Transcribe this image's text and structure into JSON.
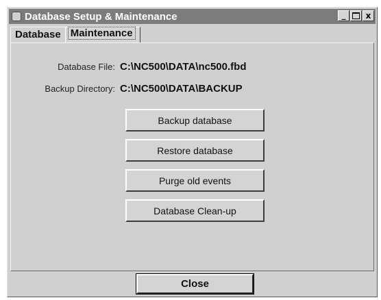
{
  "window": {
    "title": "Database Setup & Maintenance",
    "title_buttons": {
      "minimize_glyph": "_",
      "close_glyph": "x"
    }
  },
  "tabs": [
    {
      "label": "Database",
      "active": false
    },
    {
      "label": "Maintenance",
      "active": true
    }
  ],
  "maintenance": {
    "database_file_label": "Database File:",
    "database_file_value": "C:\\NC500\\DATA\\nc500.fbd",
    "backup_dir_label": "Backup Directory:",
    "backup_dir_value": "C:\\NC500\\DATA\\BACKUP",
    "buttons": [
      "Backup database",
      "Restore database",
      "Purge old events",
      "Database Clean-up"
    ]
  },
  "footer": {
    "close_label": "Close"
  },
  "colors": {
    "titlebar": "#7c7c7c",
    "window_face": "#d0d0d0"
  }
}
